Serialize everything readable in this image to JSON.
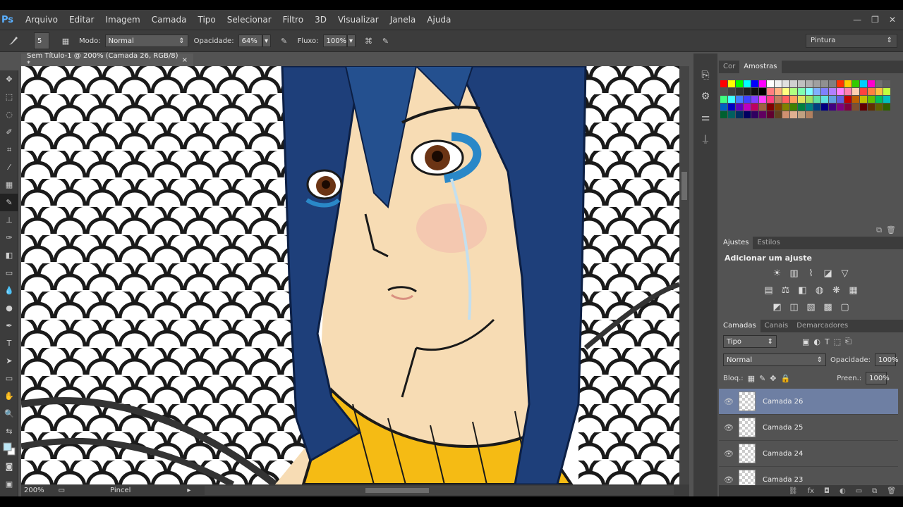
{
  "app": {
    "logo": "Ps"
  },
  "menu": [
    "Arquivo",
    "Editar",
    "Imagem",
    "Camada",
    "Tipo",
    "Selecionar",
    "Filtro",
    "3D",
    "Visualizar",
    "Janela",
    "Ajuda"
  ],
  "window_controls": {
    "minimize": "—",
    "restore": "❐",
    "close": "✕"
  },
  "options": {
    "brush_size": "5",
    "mode_label": "Modo:",
    "mode_value": "Normal",
    "opacity_label": "Opacidade:",
    "opacity_value": "64%",
    "flow_label": "Fluxo:",
    "flow_value": "100%"
  },
  "workspace": "Pintura",
  "document_tab": {
    "title": "Sem Título-1 @ 200% (Camada 26, RGB/8) *",
    "close": "×"
  },
  "status": {
    "zoom": "200%",
    "tool": "Pincel"
  },
  "swatches_panel": {
    "tabs": [
      "Cor",
      "Amostras"
    ],
    "active_tab": "Amostras",
    "colors": [
      "#ff0000",
      "#ffff00",
      "#00ff00",
      "#00ffff",
      "#0000ff",
      "#ff00ff",
      "#ffffff",
      "#f0f0f0",
      "#e0e0e0",
      "#d0d0d0",
      "#c0c0c0",
      "#b0b0b0",
      "#a0a0a0",
      "#909090",
      "#808080",
      "#ff3300",
      "#ffcc00",
      "#33cc00",
      "#00ccff",
      "#ff00cc",
      "#707070",
      "#606060",
      "#505050",
      "#404040",
      "#303030",
      "#202020",
      "#101010",
      "#000000",
      "#ff8080",
      "#ffb080",
      "#ffff80",
      "#b0ff80",
      "#80ffb0",
      "#80ffff",
      "#80b0ff",
      "#8080ff",
      "#b080ff",
      "#ff80ff",
      "#ff80b0",
      "#ffd0b0",
      "#ff4040",
      "#ff8040",
      "#ffc040",
      "#c0ff40",
      "#40ff80",
      "#40ffff",
      "#4080ff",
      "#4040ff",
      "#8040ff",
      "#ff40ff",
      "#ff4080",
      "#c08060",
      "#ff6060",
      "#ffa060",
      "#e0e060",
      "#a0e060",
      "#60e0a0",
      "#60e0e0",
      "#60a0e0",
      "#6060e0",
      "#c00000",
      "#c06000",
      "#c0c000",
      "#60c000",
      "#00c060",
      "#00c0c0",
      "#0060c0",
      "#0000c0",
      "#6000c0",
      "#c000c0",
      "#c00060",
      "#a06040",
      "#800000",
      "#804000",
      "#808000",
      "#408000",
      "#008040",
      "#008080",
      "#004080",
      "#000080",
      "#400080",
      "#800080",
      "#800040",
      "#805030",
      "#600000",
      "#603000",
      "#606000",
      "#306000",
      "#006030",
      "#006060",
      "#003060",
      "#000060",
      "#300060",
      "#600060",
      "#600030",
      "#604020",
      "#d09070",
      "#e0b090",
      "#c0a080",
      "#b08060"
    ]
  },
  "adjustments_panel": {
    "tabs": [
      "Ajustes",
      "Estilos"
    ],
    "active_tab": "Ajustes",
    "title": "Adicionar um ajuste"
  },
  "layers_panel": {
    "tabs": [
      "Camadas",
      "Canais",
      "Demarcadores"
    ],
    "active_tab": "Camadas",
    "filter_label": "Tipo",
    "blend_mode": "Normal",
    "opacity_label": "Opacidade:",
    "opacity_value": "100%",
    "lock_label": "Bloq.:",
    "fill_label": "Preen.:",
    "fill_value": "100%",
    "layers": [
      {
        "name": "Camada 26",
        "selected": true
      },
      {
        "name": "Camada 25",
        "selected": false
      },
      {
        "name": "Camada 24",
        "selected": false
      },
      {
        "name": "Camada 23",
        "selected": false
      }
    ]
  }
}
